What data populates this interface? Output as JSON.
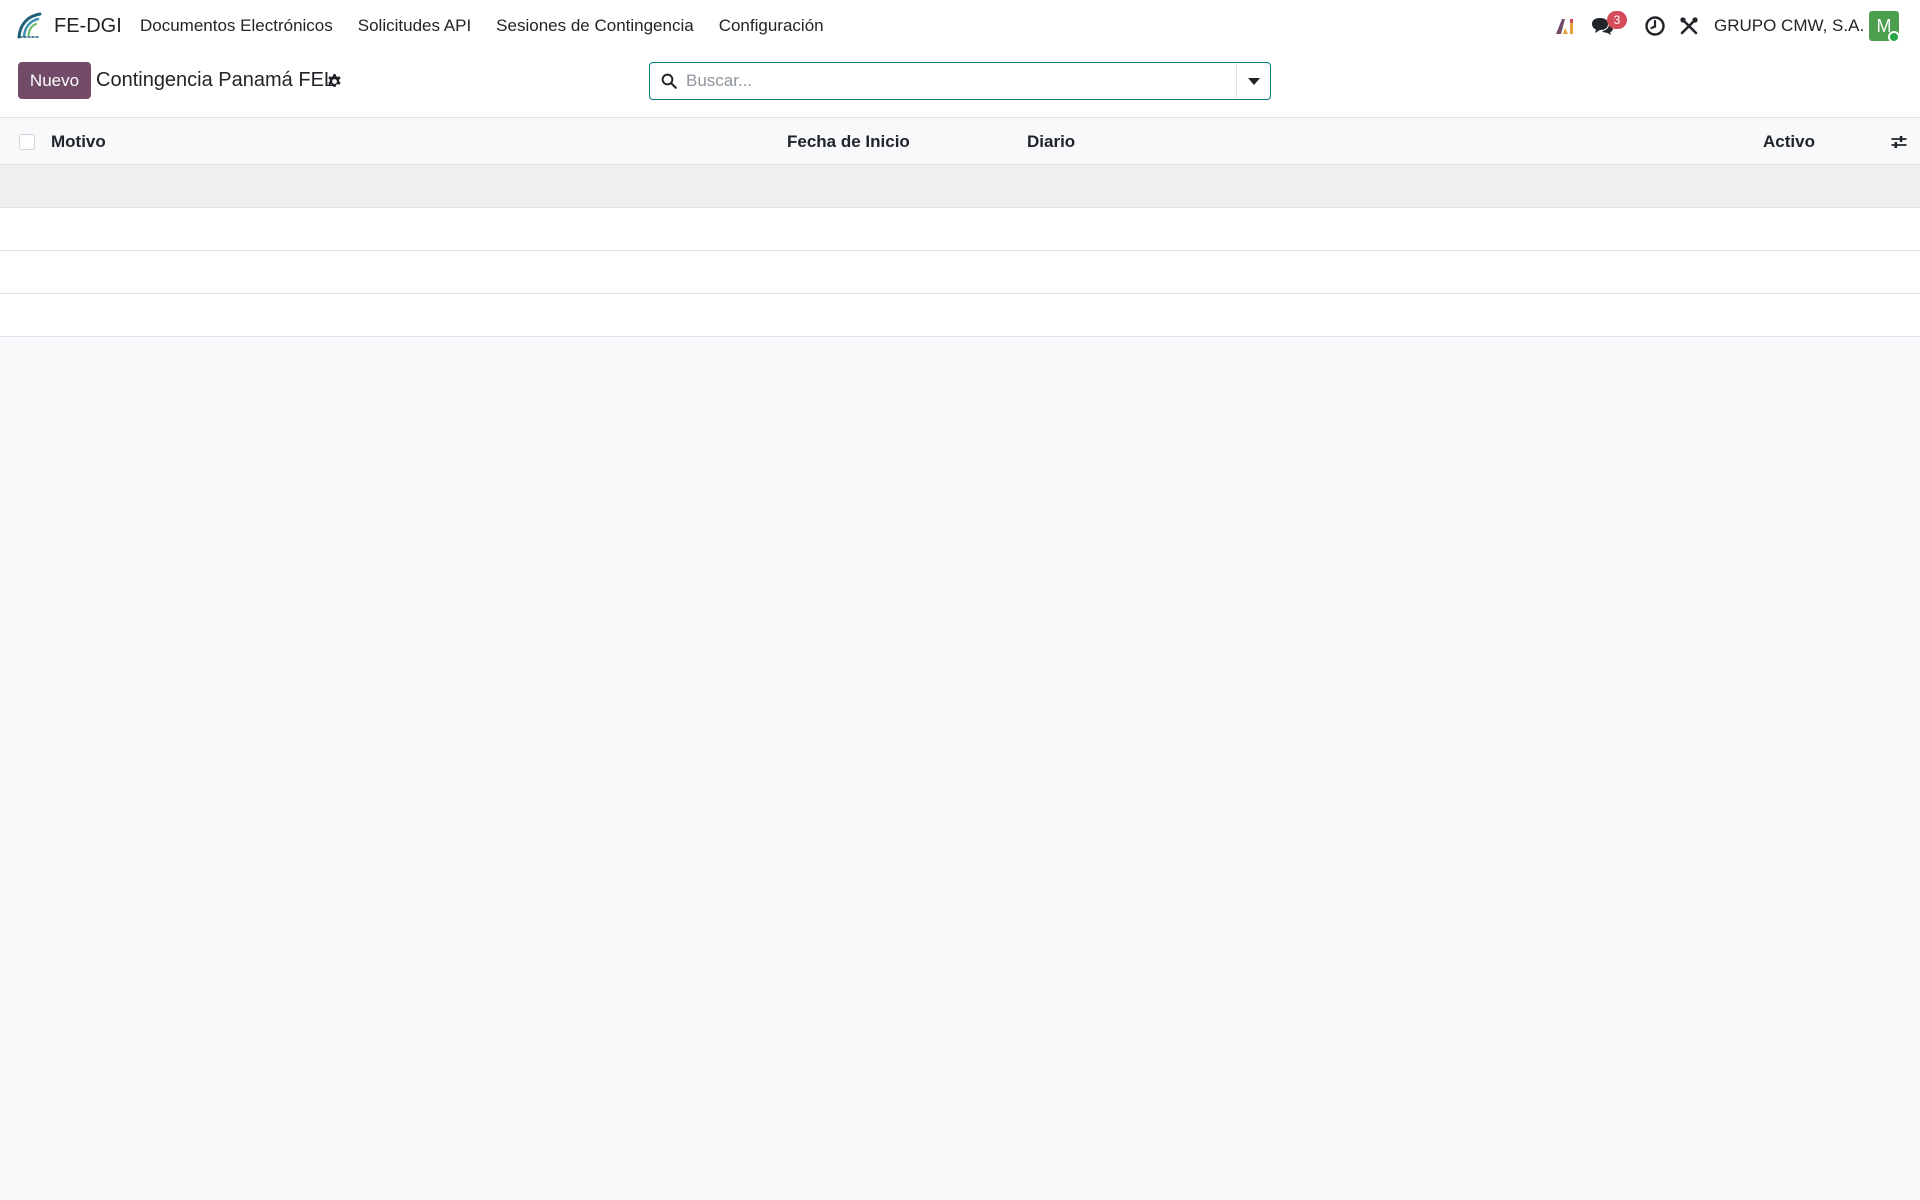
{
  "navbar": {
    "app_name": "FE-DGI",
    "menu": [
      {
        "label": "Documentos Electrónicos"
      },
      {
        "label": "Solicitudes API"
      },
      {
        "label": "Sesiones de Contingencia"
      },
      {
        "label": "Configuración"
      }
    ],
    "systray": {
      "ai_icon": "ai-assistant-icon",
      "messages_icon": "chat-bubbles-icon",
      "messages_count": "3",
      "activity_icon": "clock-icon",
      "tools_icon": "tools-icon",
      "company": "GRUPO CMW, S.A.",
      "avatar_letter": "M"
    }
  },
  "control_panel": {
    "new_label": "Nuevo",
    "title": "Contingencia Panamá FEL",
    "search_placeholder": "Buscar..."
  },
  "list": {
    "columns": [
      {
        "label": "Motivo"
      },
      {
        "label": "Fecha de Inicio"
      },
      {
        "label": "Diario"
      },
      {
        "label": "Activo"
      }
    ],
    "rows": 4
  },
  "colors": {
    "primary": "#714b67",
    "search_border": "#017e84",
    "badge": "#d44c59",
    "avatar": "#4c9f4c"
  }
}
